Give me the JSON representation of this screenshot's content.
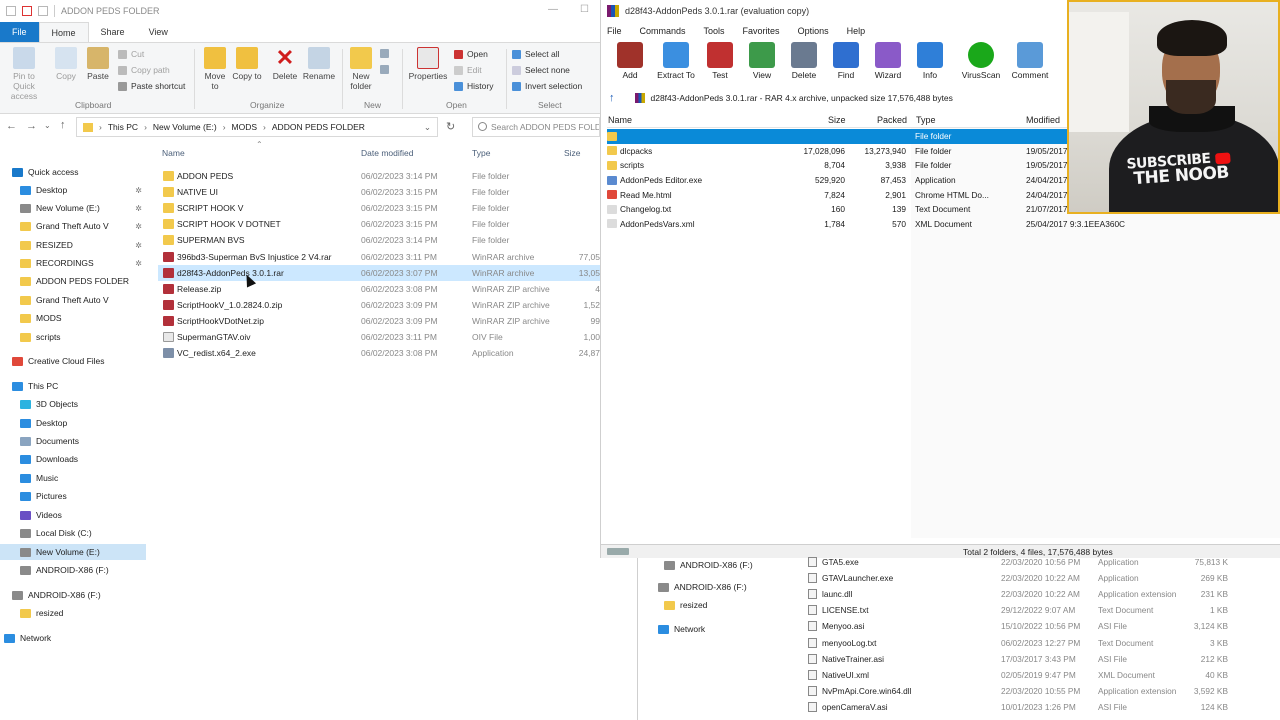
{
  "explorer": {
    "title": "ADDON PEDS FOLDER",
    "tabs": [
      "File",
      "Home",
      "Share",
      "View"
    ],
    "ribbon": {
      "clipboard": {
        "pin": "Pin to Quick access",
        "copy": "Copy",
        "paste": "Paste",
        "cut": "Cut",
        "copy_path": "Copy path",
        "paste_shortcut": "Paste shortcut",
        "group": "Clipboard"
      },
      "organize": {
        "move_to": "Move to",
        "copy_to": "Copy to",
        "delete": "Delete",
        "rename": "Rename",
        "group": "Organize"
      },
      "new": {
        "new_folder": "New folder",
        "group": "New"
      },
      "open": {
        "properties": "Properties",
        "open": "Open",
        "edit": "Edit",
        "history": "History",
        "group": "Open"
      },
      "select": {
        "select_all": "Select all",
        "select_none": "Select none",
        "invert": "Invert selection",
        "group": "Select"
      }
    },
    "breadcrumb": [
      "This PC",
      "New Volume (E:)",
      "MODS",
      "ADDON PEDS FOLDER"
    ],
    "search_placeholder": "Search ADDON PEDS FOLDER",
    "columns": {
      "name": "Name",
      "date": "Date modified",
      "type": "Type",
      "size": "Size"
    },
    "nav": [
      {
        "label": "Quick access",
        "color": "#1979ca",
        "pinned": false
      },
      {
        "label": "Desktop",
        "color": "#2b8de0",
        "pinned": true
      },
      {
        "label": "New Volume (E:)",
        "color": "#8a8a8a",
        "pinned": true
      },
      {
        "label": "Grand Theft Auto V",
        "color": "#f2c94c",
        "pinned": true
      },
      {
        "label": "RESIZED",
        "color": "#f2c94c",
        "pinned": true
      },
      {
        "label": "RECORDINGS",
        "color": "#f2c94c",
        "pinned": true
      },
      {
        "label": "ADDON PEDS FOLDER",
        "color": "#f2c94c",
        "pinned": false
      },
      {
        "label": "Grand Theft Auto V",
        "color": "#f2c94c",
        "pinned": false
      },
      {
        "label": "MODS",
        "color": "#f2c94c",
        "pinned": false
      },
      {
        "label": "scripts",
        "color": "#f2c94c",
        "pinned": false
      },
      {
        "label": "Creative Cloud Files",
        "color": "#e0483a",
        "pinned": false
      },
      {
        "label": "This PC",
        "color": "#2b8de0",
        "pinned": false
      },
      {
        "label": "3D Objects",
        "color": "#2bb3e0",
        "pinned": false
      },
      {
        "label": "Desktop",
        "color": "#2b8de0",
        "pinned": false
      },
      {
        "label": "Documents",
        "color": "#8aa4c0",
        "pinned": false
      },
      {
        "label": "Downloads",
        "color": "#2b8de0",
        "pinned": false
      },
      {
        "label": "Music",
        "color": "#2b8de0",
        "pinned": false
      },
      {
        "label": "Pictures",
        "color": "#2b8de0",
        "pinned": false
      },
      {
        "label": "Videos",
        "color": "#6a4fc4",
        "pinned": false
      },
      {
        "label": "Local Disk (C:)",
        "color": "#8a8a8a",
        "pinned": false
      },
      {
        "label": "New Volume (E:)",
        "color": "#8a8a8a",
        "pinned": false
      },
      {
        "label": "ANDROID-X86 (F:)",
        "color": "#8a8a8a",
        "pinned": false
      },
      {
        "label": "ANDROID-X86 (F:)",
        "color": "#8a8a8a",
        "pinned": false
      },
      {
        "label": "resized",
        "color": "#f2c94c",
        "pinned": false
      },
      {
        "label": "Network",
        "color": "#2b8de0",
        "pinned": false
      }
    ],
    "files": [
      {
        "name": "ADDON PEDS",
        "date": "06/02/2023 3:14 PM",
        "type": "File folder",
        "size": "",
        "icon": "folder"
      },
      {
        "name": "NATIVE UI",
        "date": "06/02/2023 3:15 PM",
        "type": "File folder",
        "size": "",
        "icon": "folder"
      },
      {
        "name": "SCRIPT HOOK V",
        "date": "06/02/2023 3:15 PM",
        "type": "File folder",
        "size": "",
        "icon": "folder"
      },
      {
        "name": "SCRIPT HOOK V DOTNET",
        "date": "06/02/2023 3:15 PM",
        "type": "File folder",
        "size": "",
        "icon": "folder"
      },
      {
        "name": "SUPERMAN BVS",
        "date": "06/02/2023 3:14 PM",
        "type": "File folder",
        "size": "",
        "icon": "folder"
      },
      {
        "name": "396bd3-Superman BvS Injustice 2 V4.rar",
        "date": "06/02/2023 3:11 PM",
        "type": "WinRAR archive",
        "size": "77,05",
        "icon": "rar"
      },
      {
        "name": "d28f43-AddonPeds 3.0.1.rar",
        "date": "06/02/2023 3:07 PM",
        "type": "WinRAR archive",
        "size": "13,05",
        "icon": "rar"
      },
      {
        "name": "Release.zip",
        "date": "06/02/2023 3:08 PM",
        "type": "WinRAR ZIP archive",
        "size": "4",
        "icon": "rar"
      },
      {
        "name": "ScriptHookV_1.0.2824.0.zip",
        "date": "06/02/2023 3:09 PM",
        "type": "WinRAR ZIP archive",
        "size": "1,52",
        "icon": "rar"
      },
      {
        "name": "ScriptHookVDotNet.zip",
        "date": "06/02/2023 3:09 PM",
        "type": "WinRAR ZIP archive",
        "size": "99",
        "icon": "rar"
      },
      {
        "name": "SupermanGTAV.oiv",
        "date": "06/02/2023 3:11 PM",
        "type": "OIV File",
        "size": "1,00",
        "icon": "file"
      },
      {
        "name": "VC_redist.x64_2.exe",
        "date": "06/02/2023 3:08 PM",
        "type": "Application",
        "size": "24,87",
        "icon": "exe"
      }
    ]
  },
  "winrar": {
    "title": "d28f43-AddonPeds 3.0.1.rar (evaluation copy)",
    "menu": [
      "File",
      "Commands",
      "Tools",
      "Favorites",
      "Options",
      "Help"
    ],
    "tools": [
      {
        "label": "Add",
        "color": "#a0322a"
      },
      {
        "label": "Extract To",
        "color": "#3b8fe0"
      },
      {
        "label": "Test",
        "color": "#c03030"
      },
      {
        "label": "View",
        "color": "#3d9a4a"
      },
      {
        "label": "Delete",
        "color": "#6a7a90"
      },
      {
        "label": "Find",
        "color": "#2f6fd0"
      },
      {
        "label": "Wizard",
        "color": "#8a5ac8"
      },
      {
        "label": "Info",
        "color": "#2f7fd8"
      },
      {
        "label": "VirusScan",
        "color": "#1aa81a"
      },
      {
        "label": "Comment",
        "color": "#5a9ad8"
      }
    ],
    "path": "d28f43-AddonPeds 3.0.1.rar - RAR 4.x archive, unpacked size 17,576,488 bytes",
    "columns": {
      "name": "Name",
      "size": "Size",
      "packed": "Packed",
      "type": "Type",
      "modified": "Modified"
    },
    "rows": [
      {
        "name": "..",
        "size": "",
        "packed": "",
        "type": "File folder",
        "modified": "",
        "crc": "",
        "icon": "#f2c94c",
        "selected": true
      },
      {
        "name": "dlcpacks",
        "size": "17,028,096",
        "packed": "13,273,940",
        "type": "File folder",
        "modified": "19/05/2017 3:...",
        "crc": "",
        "icon": "#f2c94c",
        "selected": false
      },
      {
        "name": "scripts",
        "size": "8,704",
        "packed": "3,938",
        "type": "File folder",
        "modified": "19/05/2017 3:...",
        "crc": "",
        "icon": "#f2c94c",
        "selected": false
      },
      {
        "name": "AddonPeds Editor.exe",
        "size": "529,920",
        "packed": "87,453",
        "type": "Application",
        "modified": "24/04/2017 12:...",
        "crc": "",
        "icon": "#5a8ad0",
        "selected": false
      },
      {
        "name": "Read Me.html",
        "size": "7,824",
        "packed": "2,901",
        "type": "Chrome HTML Do...",
        "modified": "24/04/2017 12:...",
        "crc": "",
        "icon": "#e0483a",
        "selected": false
      },
      {
        "name": "Changelog.txt",
        "size": "160",
        "packed": "139",
        "type": "Text Document",
        "modified": "21/07/2017 11:...",
        "crc": "",
        "icon": "#dcdcdc",
        "selected": false
      },
      {
        "name": "AddonPedsVars.xml",
        "size": "1,784",
        "packed": "570",
        "type": "XML Document",
        "modified": "25/04/2017 9:3...",
        "crc": "1EEA360C",
        "icon": "#dcdcdc",
        "selected": false
      }
    ],
    "status": "Total 2 folders, 4 files, 17,576,488 bytes"
  },
  "lower": {
    "nav": [
      {
        "label": "ANDROID-X86 (F:)",
        "color": "#8a8a8a"
      },
      {
        "label": "ANDROID-X86 (F:)",
        "color": "#8a8a8a"
      },
      {
        "label": "resized",
        "color": "#f2c94c"
      },
      {
        "label": "Network",
        "color": "#2b8de0"
      }
    ],
    "files": [
      {
        "name": "GTA5.exe",
        "date": "22/03/2020 10:56 PM",
        "type": "Application",
        "size": "75,813 K"
      },
      {
        "name": "GTAVLauncher.exe",
        "date": "22/03/2020 10:22 AM",
        "type": "Application",
        "size": "269 KB"
      },
      {
        "name": "launc.dll",
        "date": "22/03/2020 10:22 AM",
        "type": "Application extension",
        "size": "231 KB"
      },
      {
        "name": "LICENSE.txt",
        "date": "29/12/2022 9:07 AM",
        "type": "Text Document",
        "size": "1 KB"
      },
      {
        "name": "Menyoo.asi",
        "date": "15/10/2022 10:56 PM",
        "type": "ASI File",
        "size": "3,124 KB"
      },
      {
        "name": "menyooLog.txt",
        "date": "06/02/2023 12:27 PM",
        "type": "Text Document",
        "size": "3 KB"
      },
      {
        "name": "NativeTrainer.asi",
        "date": "17/03/2017 3:43 PM",
        "type": "ASI File",
        "size": "212 KB"
      },
      {
        "name": "NativeUI.xml",
        "date": "02/05/2019 9:47 PM",
        "type": "XML Document",
        "size": "40 KB"
      },
      {
        "name": "NvPmApi.Core.win64.dll",
        "date": "22/03/2020 10:55 PM",
        "type": "Application extension",
        "size": "3,592 KB"
      },
      {
        "name": "openCameraV.asi",
        "date": "10/01/2023 1:26 PM",
        "type": "ASI File",
        "size": "124 KB"
      }
    ]
  },
  "webcam": {
    "line1": "SUBSCRIBE",
    "line2": "THE NOOB"
  }
}
